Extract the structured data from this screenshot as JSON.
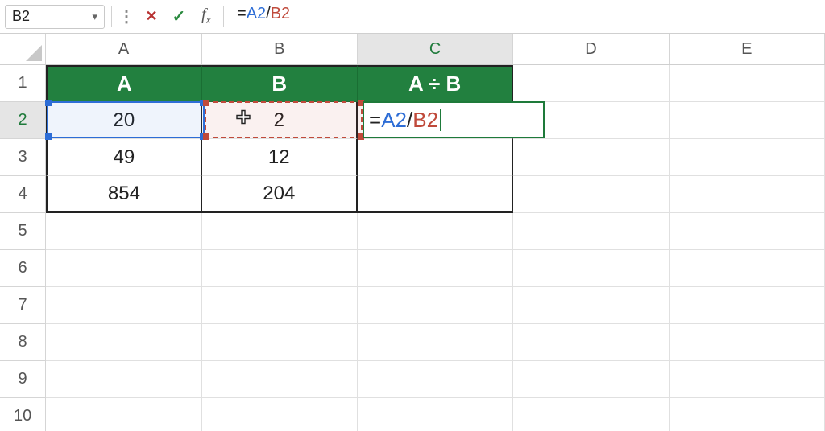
{
  "formula_bar": {
    "name_box": "B2",
    "formula": "=A2/B2",
    "formula_parts": {
      "eq": "=",
      "refA": "A2",
      "sep": "/",
      "refB": "B2"
    }
  },
  "column_headers": [
    "A",
    "B",
    "C",
    "D",
    "E"
  ],
  "active_col_index": 2,
  "row_headers": [
    "1",
    "2",
    "3",
    "4",
    "5",
    "6",
    "7",
    "8",
    "9",
    "10"
  ],
  "active_row_index": 1,
  "table": {
    "headers": {
      "A": "A",
      "B": "B",
      "C": "A ÷ B"
    },
    "rows": [
      {
        "A": "20",
        "B": "2",
        "C": ""
      },
      {
        "A": "49",
        "B": "12",
        "C": ""
      },
      {
        "A": "854",
        "B": "204",
        "C": ""
      }
    ]
  },
  "editing_cell": {
    "ref": "C2",
    "parts": {
      "eq": "=",
      "refA": "A2",
      "sep": "/",
      "refB": "B2"
    }
  },
  "colors": {
    "header_green": "#22803f",
    "ref_blue": "#2d6dd6",
    "ref_red": "#c04a3b",
    "selection_green": "#1e7a3a"
  }
}
